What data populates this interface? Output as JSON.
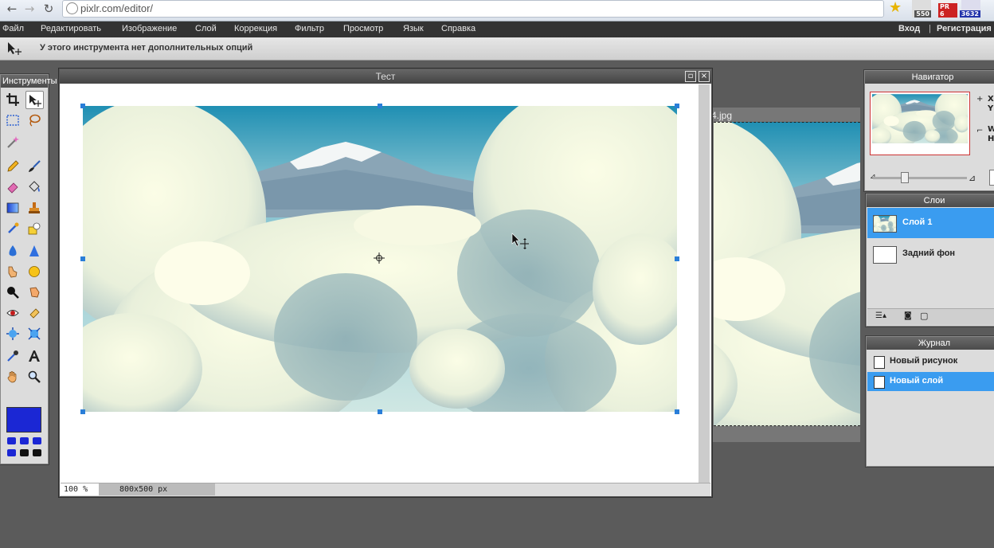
{
  "browser": {
    "url": "pixlr.com/editor/",
    "ext_badges": [
      "550",
      "PR 6",
      "3632"
    ]
  },
  "menubar": {
    "items": [
      "Файл",
      "Редактировать",
      "Изображение",
      "Слой",
      "Коррекция",
      "Фильтр",
      "Просмотр",
      "Язык",
      "Справка"
    ],
    "login": "Вход",
    "separator": "|",
    "register": "Регистрация"
  },
  "options": {
    "text": "У этого инструмента нет дополнительных опций"
  },
  "tools": {
    "title": "Инструменты",
    "fg_color": "#1b27d4"
  },
  "document": {
    "title": "Тест",
    "zoom": "100 %",
    "dimensions": "800x500 px"
  },
  "document2": {
    "title": "4.jpg"
  },
  "navigator": {
    "title": "Навигатор",
    "x_label": "X",
    "y_label": "Y",
    "w_label": "W",
    "h_label": "H"
  },
  "layers": {
    "title": "Слои",
    "items": [
      {
        "name": "Слой 1",
        "selected": true
      },
      {
        "name": "Задний фон",
        "selected": false
      }
    ]
  },
  "history": {
    "title": "Журнал",
    "items": [
      {
        "name": "Новый рисунок",
        "selected": false
      },
      {
        "name": "Новый слой",
        "selected": true
      }
    ]
  },
  "colors": {
    "selection": "#3a9cf0",
    "menubar": "#333333",
    "foreground": "#1b27d4"
  }
}
